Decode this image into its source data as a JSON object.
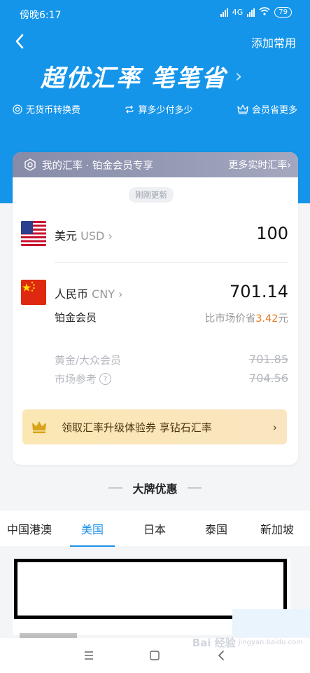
{
  "status_bar": {
    "time": "傍晚6:17",
    "network": "4G",
    "battery": "79"
  },
  "header": {
    "add_favorite": "添加常用"
  },
  "banner": {
    "title": "超优汇率 笔笔省"
  },
  "features": [
    {
      "icon": "coin-icon",
      "label": "无货币转换费"
    },
    {
      "icon": "swap-icon",
      "label": "算多少付多少"
    },
    {
      "icon": "crown-icon",
      "label": "会员省更多"
    }
  ],
  "card": {
    "header_title": "我的汇率 · 铂金会员专享",
    "more_rates": "更多实时汇率",
    "updated_badge": "刚刚更新",
    "from": {
      "name": "美元",
      "code": "USD",
      "amount": "100"
    },
    "to": {
      "name": "人民币",
      "code": "CNY",
      "amount": "701.14"
    },
    "member_level": "铂金会员",
    "saving_prefix": "比市场价省",
    "saving_amount": "3.42",
    "saving_unit": "元",
    "gold_label": "黄金/大众会员",
    "gold_value": "701.85",
    "market_label": "市场参考",
    "market_value": "704.56",
    "promo_text": "领取汇率升级体验券 享钻石汇率"
  },
  "section": {
    "title": "大牌优惠"
  },
  "tabs": [
    {
      "label": "中国港澳",
      "active": false
    },
    {
      "label": "美国",
      "active": true
    },
    {
      "label": "日本",
      "active": false
    },
    {
      "label": "泰国",
      "active": false
    },
    {
      "label": "新加坡",
      "active": false
    }
  ],
  "watermark": {
    "brand": "Bai 经验",
    "url": "jingyan.baidu.com"
  },
  "colors": {
    "primary": "#1595ea",
    "accent": "#ef7b1c",
    "tab_active": "#1a8fe6"
  }
}
